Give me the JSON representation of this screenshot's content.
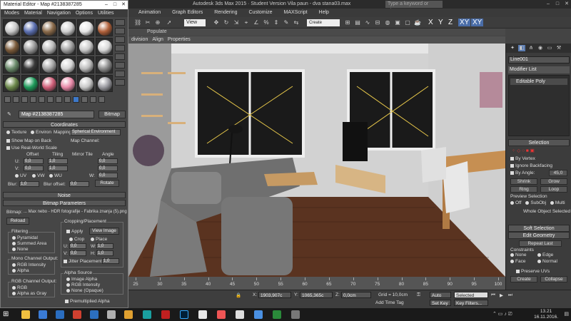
{
  "max_window": {
    "title": "Autodesk 3ds Max 2015  ·  Student Version     Vila paun - dva stana03.max",
    "search_placeholder": "Type a keyword or phrase",
    "menus": [
      "Animation",
      "Graph Editors",
      "Rendering",
      "Customize",
      "MAXScript",
      "Help"
    ],
    "viewport_dropdown": "View",
    "selection_set": "Create Selection Se",
    "axis_buttons": [
      "X",
      "Y",
      "Z",
      "XY",
      "XY"
    ],
    "ribbon_tabs": [
      "Populate"
    ],
    "viewport_tabs": [
      "division",
      "Align",
      "Properties"
    ]
  },
  "command_panel": {
    "object_name": "Line001",
    "modifier_list": "Modifier List",
    "stack_item": "Editable Poly",
    "selection_rollout": "Selection",
    "by_vertex": "By Vertex",
    "ignore_backfacing": "Ignore Backfacing",
    "by_angle_label": "By Angle:",
    "by_angle_value": "45,0",
    "shrink": "Shrink",
    "grow": "Grow",
    "ring": "Ring",
    "loop": "Loop",
    "preview_selection": "Preview Selection",
    "preview_options": [
      "Off",
      "SubObj",
      "Multi"
    ],
    "whole_object": "Whole Object Selected",
    "soft_selection": "Soft Selection",
    "edit_geometry": "Edit Geometry",
    "repeat_last": "Repeat Last",
    "constraints": "Constraints",
    "constraint_opts": [
      "None",
      "Edge",
      "Face",
      "Normal"
    ],
    "preserve_uvs": "Preserve UVs",
    "create": "Create",
    "collapse": "Collapse"
  },
  "timeline": {
    "ticks": [
      "25",
      "30",
      "35",
      "40",
      "45",
      "50",
      "55",
      "60",
      "65",
      "70",
      "75",
      "80",
      "85",
      "90",
      "95",
      "100"
    ]
  },
  "statusbar": {
    "x_value": "1903,907c",
    "y_value": "1065,365c",
    "z_label": "Z:",
    "z_value": "0,0cm",
    "grid": "Grid = 10,0cm",
    "auto_key": "Auto Key",
    "selected": "Selected",
    "set_key": "Set Key",
    "key_filters": "Key Filters...",
    "add_time_tag": "Add Time Tag"
  },
  "material_editor": {
    "title": "Material Editor - Map #2138387285",
    "menus": [
      "Modes",
      "Material",
      "Navigation",
      "Options",
      "Utilities"
    ],
    "map_name": "Map #2138387285",
    "map_type": "Bitmap",
    "coordinates_title": "Coordinates",
    "texture": "Texture",
    "environ": "Environ",
    "mapping_label": "Mapping:",
    "mapping_value": "Spherical Environment",
    "show_map_on_back": "Show Map on Back",
    "map_channel_label": "Map Channel:",
    "use_real_world": "Use Real-World Scale",
    "col_offset": "Offset",
    "col_tiling": "Tiling",
    "col_mirror_tile": "Mirror Tile",
    "col_angle": "Angle",
    "u_label": "U:",
    "v_label": "V:",
    "w_label": "W:",
    "u_offset": "0,0",
    "u_tiling": "1,0",
    "u_angle": "0,0",
    "v_offset": "0,0",
    "v_tiling": "1,0",
    "v_angle": "0,0",
    "w_angle": "0,0",
    "uv": "UV",
    "vw": "VW",
    "wu": "WU",
    "blur_label": "Blur:",
    "blur_value": "1,0",
    "blur_offset_label": "Blur offset:",
    "blur_offset_value": "0,0",
    "rotate": "Rotate",
    "noise_title": "Noise",
    "bitmap_params_title": "Bitmap Parameters",
    "bitmap_label": "Bitmap:",
    "bitmap_path": "... Max nebo - HDR fotografije - Fabrika znanja (5).png",
    "reload": "Reload",
    "cropping_placement": "Cropping/Placement",
    "apply": "Apply",
    "view_image": "View Image",
    "crop": "Crop",
    "place": "Place",
    "cp_u": "U:",
    "cp_v": "V:",
    "cp_w": "W:",
    "cp_h": "H:",
    "cp_u_val": "0,0",
    "cp_v_val": "0,0",
    "cp_w_val": "1,0",
    "cp_h_val": "1,0",
    "jitter": "Jitter Placement:",
    "jitter_val": "1,0",
    "filtering": "Filtering",
    "pyramidal": "Pyramidal",
    "summed_area": "Summed Area",
    "none": "None",
    "mono_output": "Mono Channel Output:",
    "rgb_intensity": "RGB Intensity",
    "alpha": "Alpha",
    "rgb_output": "RGB Channel Output:",
    "rgb": "RGB",
    "alpha_as_gray": "Alpha as Gray",
    "alpha_source": "Alpha Source",
    "image_alpha": "Image Alpha",
    "rgb_intensity2": "RGB Intensity",
    "none_opaque": "None (Opaque)",
    "premultiplied": "Premultiplied Alpha"
  },
  "sample_slots": [
    "#c9c9c9",
    "#5b6fb0",
    "#8a6a4a",
    "#d0d0d0",
    "#e6e6e6",
    "#b0603a",
    "#7a5a3a",
    "#9a9a9a",
    "#bbbbbb",
    "#a0a0a0",
    "#c9c9c9",
    "#d9d9d9",
    "#6a8a6a",
    "#3a3a3a",
    "#a7a7a7",
    "#d5d5d5",
    "#bcbcbc",
    "#8c8c8c",
    "#6d8a4c",
    "#1e9a5a",
    "#d0607a",
    "#e889a8",
    "#c8c8c8",
    "#9a9aa0"
  ],
  "taskbar": {
    "time": "13.21",
    "date": "16.11.2016."
  }
}
